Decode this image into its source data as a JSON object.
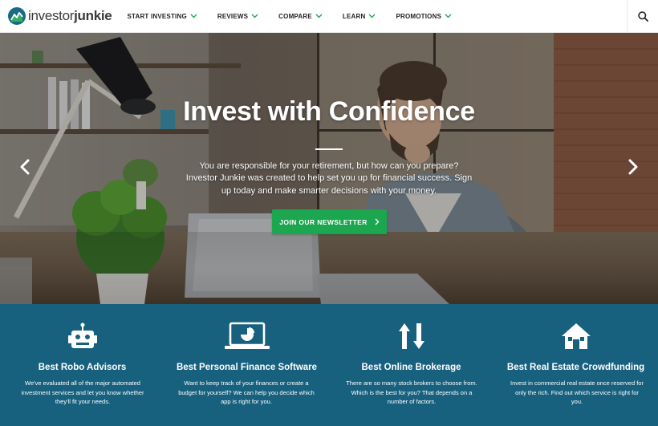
{
  "header": {
    "logo": {
      "text_light": "investor",
      "text_bold": "junkie"
    },
    "nav": [
      {
        "label": "START INVESTING"
      },
      {
        "label": "REVIEWS"
      },
      {
        "label": "COMPARE"
      },
      {
        "label": "LEARN"
      },
      {
        "label": "PROMOTIONS"
      }
    ],
    "search_icon": "search-icon",
    "accent": "#1da650"
  },
  "hero": {
    "title": "Invest with Confidence",
    "body": "You are responsible for your retirement, but how can you prepare? Investor Junkie was created to help set you up for financial success. Sign up today and make smarter decisions with your money.",
    "cta_label": "JOIN OUR NEWSLETTER",
    "prev_icon": "chevron-left-icon",
    "next_icon": "chevron-right-icon"
  },
  "features": {
    "background": "#17607e",
    "items": [
      {
        "icon": "robot-icon",
        "title": "Best Robo Advisors",
        "text": "We've evaluated all of the major automated investment services and let you know whether they'll fit your needs."
      },
      {
        "icon": "laptop-chart-icon",
        "title": "Best Personal Finance Software",
        "text": "Want to keep track of your finances or create a budget for yourself? We can help you decide which app is right for you."
      },
      {
        "icon": "up-down-arrows-icon",
        "title": "Best Online Brokerage",
        "text": "There are so many stock brokers to choose from. Which is the best for you? That depends on a number of factors."
      },
      {
        "icon": "house-icon",
        "title": "Best Real Estate Crowdfunding",
        "text": "Invest in commercial real estate once reserved for only the rich. Find out which service is right for you."
      }
    ]
  }
}
